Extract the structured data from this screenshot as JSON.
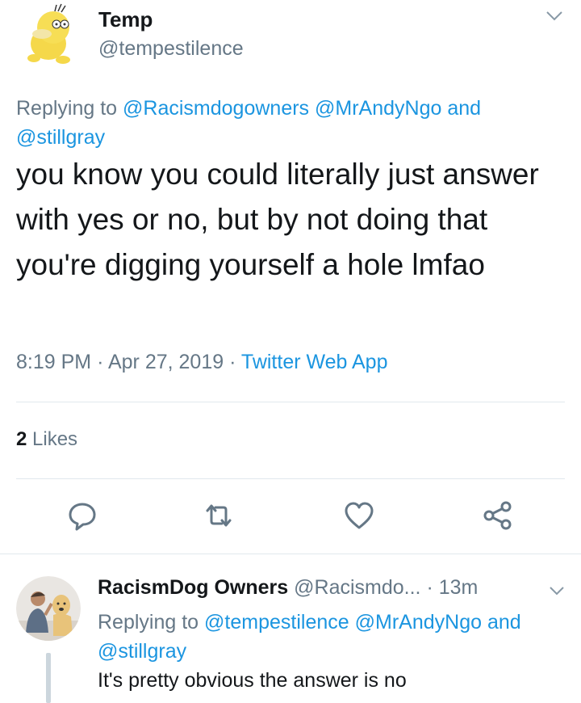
{
  "tweet": {
    "author_name": "Temp",
    "author_handle": "@tempestilence",
    "reply_label": "Replying to",
    "reply_mentions": [
      "@Racismdogowners",
      "@MrAndyNgo",
      "@stillgray"
    ],
    "reply_and": "and",
    "text": "you know you could literally just answer with yes or no, but by not doing that you're digging yourself a hole lmfao",
    "time": "8:19 PM",
    "date": "Apr 27, 2019",
    "source": "Twitter Web App",
    "separator": "·",
    "likes_count": "2",
    "likes_label": "Likes"
  },
  "actions": {
    "icons": [
      "reply-icon",
      "retweet-icon",
      "like-icon",
      "share-icon"
    ]
  },
  "reply": {
    "author_name": "RacismDog Owners",
    "author_handle": "@Racismdo...",
    "separator": "·",
    "time": "13m",
    "reply_label": "Replying to",
    "reply_mentions": [
      "@tempestilence",
      "@MrAndyNgo",
      "@stillgray"
    ],
    "reply_and": "and",
    "text": "It's pretty obvious the answer is no"
  },
  "colors": {
    "link": "#1b95e0",
    "secondary_text": "#657786",
    "primary_text": "#14171a",
    "divider": "#e1e8ed"
  }
}
